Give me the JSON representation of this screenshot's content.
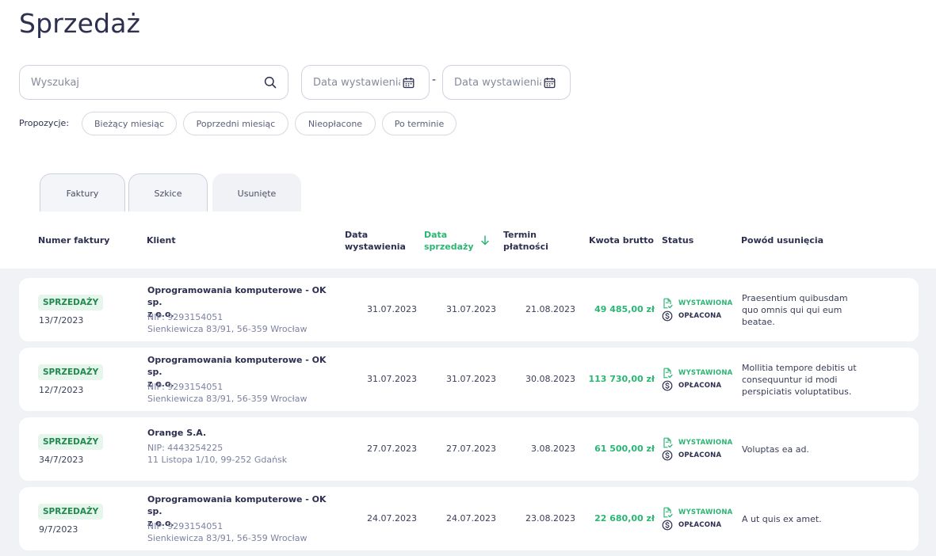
{
  "page": {
    "title": "Sprzedaż"
  },
  "filters": {
    "search_placeholder": "Wyszukaj",
    "date_from_placeholder": "Data wystawienia",
    "date_to_placeholder": "Data wystawienia",
    "dash": "-",
    "suggestions_label": "Propozycje:",
    "chips": [
      "Bieżący miesiąc",
      "Poprzedni miesiąc",
      "Nieopłacone",
      "Po terminie"
    ]
  },
  "tabs": [
    "Faktury",
    "Szkice",
    "Usunięte"
  ],
  "active_tab": "Usunięte",
  "table": {
    "headers": {
      "number": "Numer faktury",
      "client": "Klient",
      "issue_date_1": "Data",
      "issue_date_2": "wystawienia",
      "sale_date_1": "Data",
      "sale_date_2": "sprzedaży",
      "due_1": "Termin",
      "due_2": "płatności",
      "amount": "Kwota brutto",
      "status": "Status",
      "reason": "Powód usunięcia"
    },
    "rows": [
      {
        "badge": "SPRZEDAŻY",
        "number": "13/7/2023",
        "client_line1": "Oprogramowania komputerowe - OK sp.",
        "client_line2": "z o.o.",
        "nip": "NIP: 9293154051",
        "address": "Sienkiewicza 83/91, 56-359 Wrocław",
        "issue_date": "31.07.2023",
        "sale_date": "31.07.2023",
        "due_date": "21.08.2023",
        "amount": "49 485,00 zł",
        "status_issued": "WYSTAWIONA",
        "status_paid": "OPŁACONA",
        "reason": "Praesentium quibusdam quo omnis qui qui eum beatae."
      },
      {
        "badge": "SPRZEDAŻY",
        "number": "12/7/2023",
        "client_line1": "Oprogramowania komputerowe - OK sp.",
        "client_line2": "z o.o.",
        "nip": "NIP: 9293154051",
        "address": "Sienkiewicza 83/91, 56-359 Wrocław",
        "issue_date": "31.07.2023",
        "sale_date": "31.07.2023",
        "due_date": "30.08.2023",
        "amount": "113 730,00 zł",
        "status_issued": "WYSTAWIONA",
        "status_paid": "OPŁACONA",
        "reason": "Mollitia tempore debitis ut consequuntur id modi perspiciatis voluptatibus."
      },
      {
        "badge": "SPRZEDAŻY",
        "number": "34/7/2023",
        "client_line1": "Orange S.A.",
        "client_line2": "",
        "nip": "NIP: 4443254225",
        "address": "11 Listopa 1/10, 99-252 Gdańsk",
        "issue_date": "27.07.2023",
        "sale_date": "27.07.2023",
        "due_date": "3.08.2023",
        "amount": "61 500,00 zł",
        "status_issued": "WYSTAWIONA",
        "status_paid": "OPŁACONA",
        "reason": "Voluptas ea ad."
      },
      {
        "badge": "SPRZEDAŻY",
        "number": "9/7/2023",
        "client_line1": "Oprogramowania komputerowe - OK sp.",
        "client_line2": "z o.o.",
        "nip": "NIP: 9293154051",
        "address": "Sienkiewicza 83/91, 56-359 Wrocław",
        "issue_date": "24.07.2023",
        "sale_date": "24.07.2023",
        "due_date": "23.08.2023",
        "amount": "22 680,00 zł",
        "status_issued": "WYSTAWIONA",
        "status_paid": "OPŁACONA",
        "reason": "A ut quis ex amet."
      }
    ]
  },
  "colors": {
    "accent_green": "#2bb673",
    "badge_bg": "#e6f6ec",
    "text_dark": "#2d3050",
    "muted": "#7d82a0"
  },
  "icons": {
    "search": "search-icon",
    "calendar": "calendar-icon",
    "sort": "arrow-down-icon",
    "issued": "document-check-icon",
    "paid": "dollar-coin-icon"
  }
}
